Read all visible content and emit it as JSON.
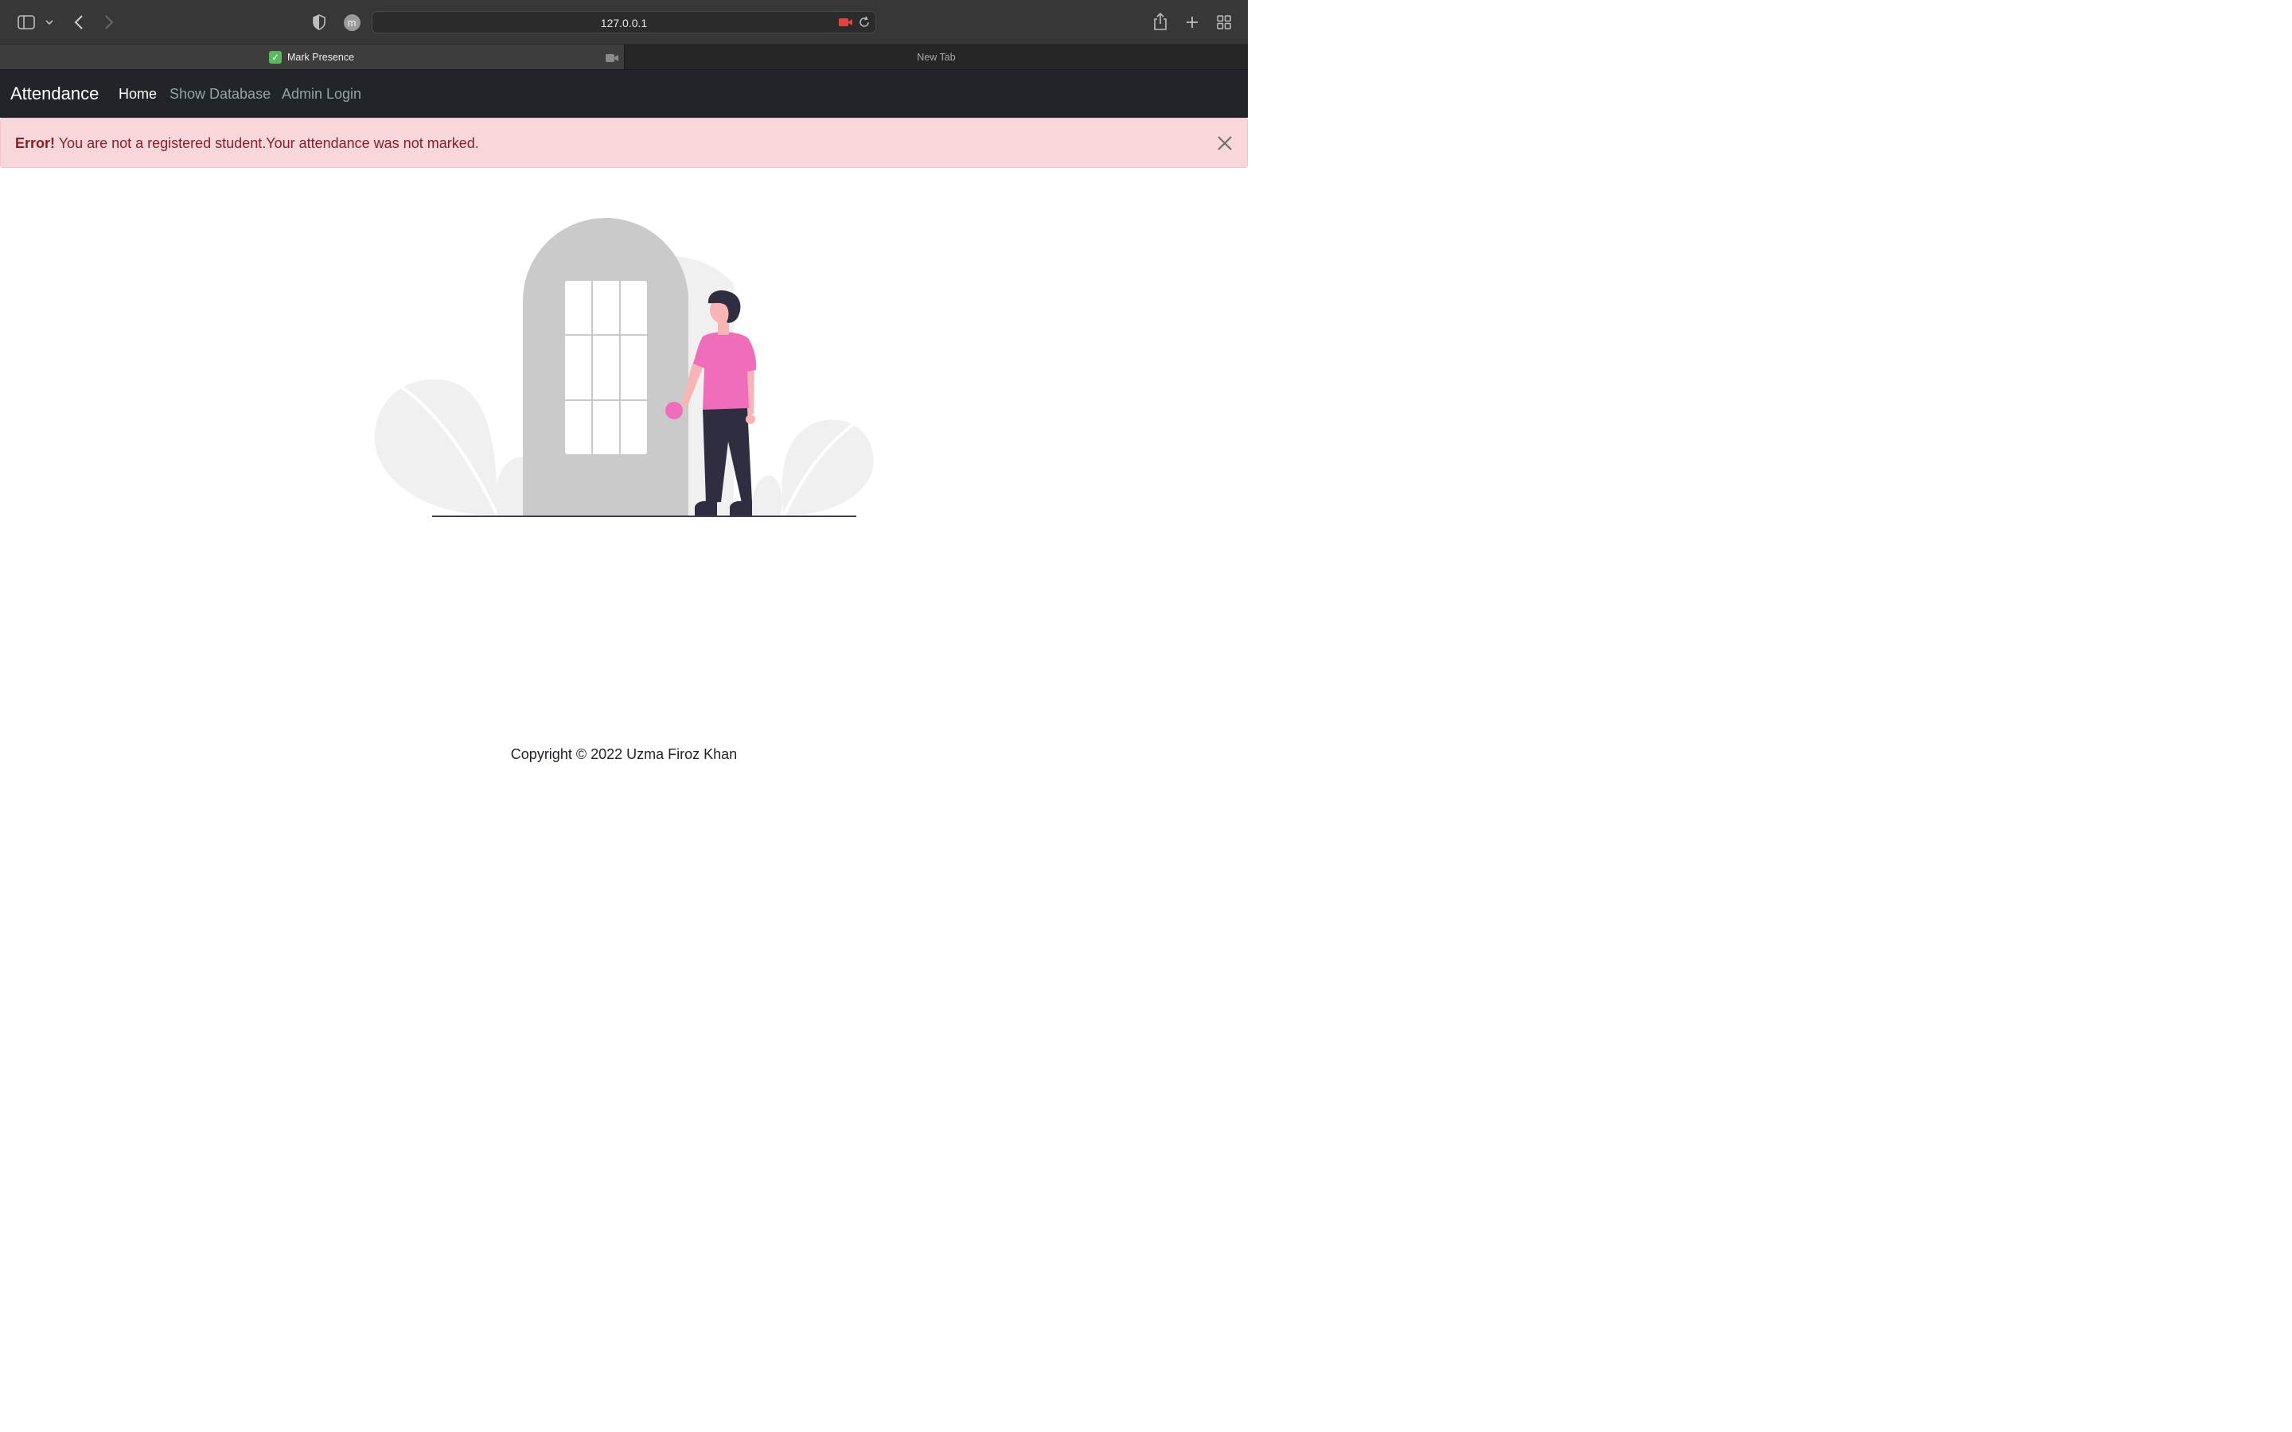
{
  "browser": {
    "url": "127.0.0.1",
    "tabs": [
      {
        "label": "Mark Presence",
        "active": true
      },
      {
        "label": "New Tab",
        "active": false
      }
    ]
  },
  "navbar": {
    "brand": "Attendance",
    "links": [
      {
        "label": "Home",
        "active": true
      },
      {
        "label": "Show Database",
        "active": false
      },
      {
        "label": "Admin Login",
        "active": false
      }
    ]
  },
  "alert": {
    "strong": "Error!",
    "message": "You are not a registered student.Your attendance was not marked."
  },
  "footer": {
    "text": "Copyright © 2022   Uzma Firoz Khan"
  },
  "colors": {
    "navbar_bg": "#212529",
    "alert_bg": "#f8d7da",
    "alert_text": "#842029",
    "accent_pink": "#f06eb9"
  }
}
